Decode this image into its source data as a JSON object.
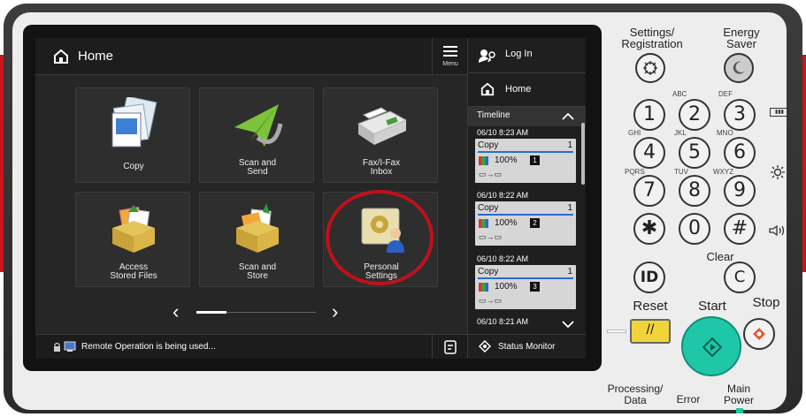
{
  "screen": {
    "title": "Home",
    "menu_label": "Menu",
    "tiles": [
      {
        "label": "Copy"
      },
      {
        "label": "Scan and\nSend"
      },
      {
        "label": "Fax/I-Fax\nInbox"
      },
      {
        "label": "Access\nStored Files"
      },
      {
        "label": "Scan and\nStore"
      },
      {
        "label": "Personal\nSettings"
      }
    ],
    "pager_prev": "‹",
    "pager_next": "›",
    "status_text": "Remote Operation is being used...",
    "status_monitor": "Status Monitor"
  },
  "sidebar": {
    "login": "Log In",
    "home": "Home",
    "timeline": "Timeline",
    "jobs": [
      {
        "time": "06/10 8:23 AM",
        "name": "Copy",
        "count": "1",
        "zoom": "100%",
        "num": "1"
      },
      {
        "time": "06/10 8:22 AM",
        "name": "Copy",
        "count": "1",
        "zoom": "100%",
        "num": "2"
      },
      {
        "time": "06/10 8:22 AM",
        "name": "Copy",
        "count": "1",
        "zoom": "100%",
        "num": "3"
      },
      {
        "time": "06/10 8:21 AM"
      }
    ]
  },
  "keypad": {
    "settings_label": "Settings/\nRegistration",
    "energy_label": "Energy\nSaver",
    "keys": [
      "1",
      "2",
      "3",
      "4",
      "5",
      "6",
      "7",
      "8",
      "9",
      "✱",
      "0",
      "#"
    ],
    "subs": [
      "ABC",
      "DEF",
      "GHI",
      "JKL",
      "MNO",
      "PQRS",
      "TUV",
      "WXYZ"
    ],
    "id_key": "ID",
    "clear_label": "Clear",
    "clear_key": "C",
    "reset_label": "Reset",
    "start_label": "Start",
    "stop_label": "Stop",
    "processing_label": "Processing/\nData",
    "error_label": "Error",
    "main_power_label": "Main\nPower"
  },
  "colors": {
    "accent_red": "#c8161d",
    "start_green": "#1ec7a8",
    "reset_yellow": "#f2d43a",
    "highlight_circle": "#c0101c"
  }
}
